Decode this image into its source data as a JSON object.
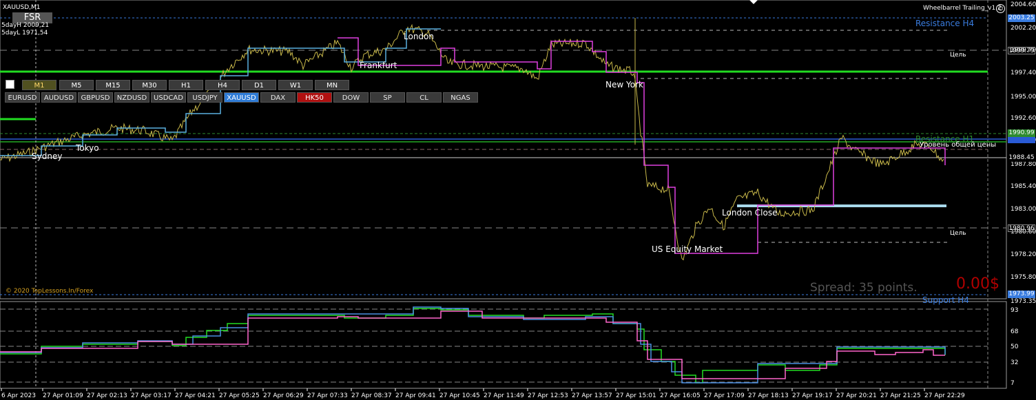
{
  "header": {
    "symbol_tf": "XAUUSD,M1",
    "day_high": "5dayH 2009,21",
    "day_low": "5dayL 1971,54",
    "fsr_label": "FSR",
    "ea_name": "Wheelbarrel Trailing_v1.2",
    "ea_icon": "smiley-icon"
  },
  "timeframes": [
    {
      "label": "M1",
      "active": true
    },
    {
      "label": "M5",
      "active": false
    },
    {
      "label": "M15",
      "active": false
    },
    {
      "label": "M30",
      "active": false
    },
    {
      "label": "H1",
      "active": false
    },
    {
      "label": "H4",
      "active": false
    },
    {
      "label": "D1",
      "active": false
    },
    {
      "label": "W1",
      "active": false
    },
    {
      "label": "MN",
      "active": false
    }
  ],
  "symbols": [
    {
      "label": "EURUSD",
      "state": "normal"
    },
    {
      "label": "AUDUSD",
      "state": "normal"
    },
    {
      "label": "GBPUSD",
      "state": "normal"
    },
    {
      "label": "NZDUSD",
      "state": "normal"
    },
    {
      "label": "USDCAD",
      "state": "normal"
    },
    {
      "label": "USDJPY",
      "state": "normal"
    },
    {
      "label": "XAUUSD",
      "state": "active"
    },
    {
      "label": "DAX",
      "state": "normal"
    },
    {
      "label": "HK50",
      "state": "red"
    },
    {
      "label": "DOW",
      "state": "normal"
    },
    {
      "label": "SP",
      "state": "normal"
    },
    {
      "label": "CL",
      "state": "normal"
    },
    {
      "label": "NGAS",
      "state": "normal"
    }
  ],
  "sessions": {
    "sydney": "Sydney",
    "tokyo": "Tokyo",
    "london": "London",
    "frankfurt": "Frankfurt",
    "new_york": "New York",
    "london_close": "London Close",
    "us_equity": "US Equity Market"
  },
  "levels": {
    "resistance_h4": "Resistance H4",
    "resistance_h1": "Resistance H1",
    "support_h4": "Support H4",
    "target": "Цель",
    "target2": "Цель",
    "general_level": "Уровень общей цены"
  },
  "price_axis": [
    "2004.60",
    "2002.20",
    "1999.79",
    "1997.40",
    "1995.00",
    "1992.60",
    "1990.20",
    "1987.80",
    "1985.40",
    "1983.00",
    "1980.60",
    "1978.20",
    "1975.80",
    "1973.35"
  ],
  "price_tags": {
    "resistance_h4": "2003.25",
    "level_1999": "1999.79",
    "resistance_h1": "1990.99",
    "blue_tag": "",
    "current": "1988.45",
    "level_1980": "1980.96",
    "support_h4": "1973.99"
  },
  "osc_axis": [
    "93",
    "68",
    "50",
    "32",
    "7"
  ],
  "time_axis": [
    "6 Apr 2023",
    "27 Apr 01:09",
    "27 Apr 02:13",
    "27 Apr 03:17",
    "27 Apr 04:21",
    "27 Apr 05:25",
    "27 Apr 06:29",
    "27 Apr 07:33",
    "27 Apr 08:37",
    "27 Apr 09:41",
    "27 Apr 10:45",
    "27 Apr 11:49",
    "27 Apr 12:53",
    "27 Apr 13:57",
    "27 Apr 15:01",
    "27 Apr 16:05",
    "27 Apr 17:09",
    "27 Apr 18:13",
    "27 Apr 19:17",
    "27 Apr 20:21",
    "27 Apr 21:25",
    "27 Apr 22:29"
  ],
  "footer": {
    "copyright": "© 2020 TopLessons.In/Forex",
    "spread": "Spread: 35 points.",
    "profit": "0.00$"
  },
  "colors": {
    "green_level": "#22dd22",
    "blue_line": "#2a5bd6",
    "light_blue": "#a8d8ea",
    "magenta": "#e040e0",
    "price": "#c8b84a",
    "resistance_h4": "#3a7de0",
    "resistance_h1": "#2e8b2e",
    "profit": "#b00000"
  }
}
